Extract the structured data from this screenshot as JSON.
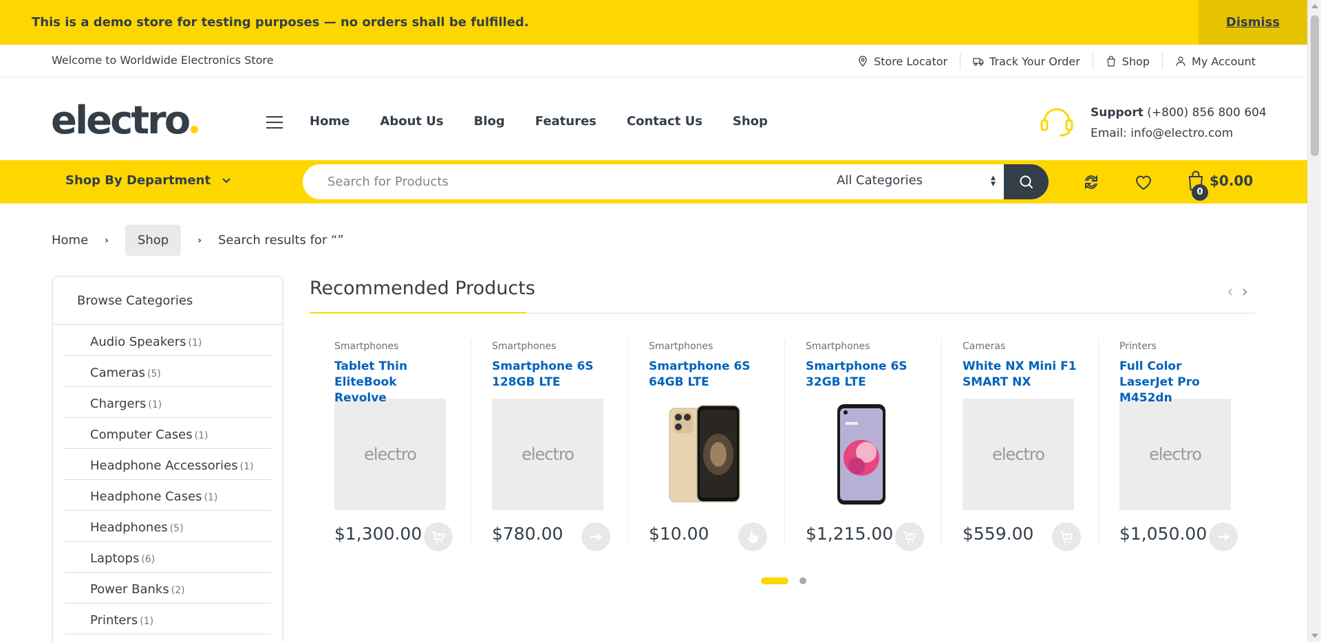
{
  "demo_bar": {
    "text": "This is a demo store for testing purposes — no orders shall be fulfilled.",
    "dismiss": "Dismiss"
  },
  "topbar": {
    "welcome": "Welcome to Worldwide Electronics Store",
    "links": [
      "Store Locator",
      "Track Your Order",
      "Shop",
      "My Account"
    ]
  },
  "header": {
    "logo": "electro",
    "nav": [
      "Home",
      "About Us",
      "Blog",
      "Features",
      "Contact Us",
      "Shop"
    ],
    "support_label": "Support",
    "support_phone": "(+800) 856 800 604",
    "email": "Email: info@electro.com"
  },
  "searchbar": {
    "department": "Shop By Department",
    "placeholder": "Search for Products",
    "category": "All Categories",
    "cart_count": "0",
    "cart_total": "$0.00"
  },
  "breadcrumb": {
    "home": "Home",
    "shop": "Shop",
    "current": "Search results for “”"
  },
  "sidebar": {
    "title": "Browse Categories",
    "categories": [
      {
        "name": "Audio Speakers",
        "count": "(1)"
      },
      {
        "name": "Cameras",
        "count": "(5)"
      },
      {
        "name": "Chargers",
        "count": "(1)"
      },
      {
        "name": "Computer Cases",
        "count": "(1)"
      },
      {
        "name": "Headphone Accessories",
        "count": "(1)"
      },
      {
        "name": "Headphone Cases",
        "count": "(1)"
      },
      {
        "name": "Headphones",
        "count": "(5)"
      },
      {
        "name": "Laptops",
        "count": "(6)"
      },
      {
        "name": "Power Banks",
        "count": "(2)"
      },
      {
        "name": "Printers",
        "count": "(1)"
      }
    ]
  },
  "recommended": {
    "title": "Recommended Products",
    "products": [
      {
        "category": "Smartphones",
        "name": "Tablet Thin EliteBook Revolve",
        "price": "$1,300.00",
        "image": "electro",
        "button": "add-to-cart-icon"
      },
      {
        "category": "Smartphones",
        "name": "Smartphone 6S 128GB LTE",
        "price": "$780.00",
        "image": "electro",
        "button": "arrow-right-icon"
      },
      {
        "category": "Smartphones",
        "name": "Smartphone 6S 64GB LTE",
        "price": "$10.00",
        "image": "phone-gold-photo",
        "button": "hand-pointer-icon"
      },
      {
        "category": "Smartphones",
        "name": "Smartphone 6S 32GB LTE",
        "price": "$1,215.00",
        "image": "phone-pink-photo",
        "button": "add-to-cart-icon"
      },
      {
        "category": "Cameras",
        "name": "White NX Mini F1 SMART NX",
        "price": "$559.00",
        "image": "electro",
        "button": "add-to-cart-icon"
      },
      {
        "category": "Printers",
        "name": "Full Color LaserJet Pro M452dn",
        "price": "$1,050.00",
        "image": "electro",
        "button": "arrow-right-icon"
      }
    ]
  },
  "colors": {
    "accent": "#fed700",
    "dark": "#333e48",
    "link": "#0062bd"
  }
}
